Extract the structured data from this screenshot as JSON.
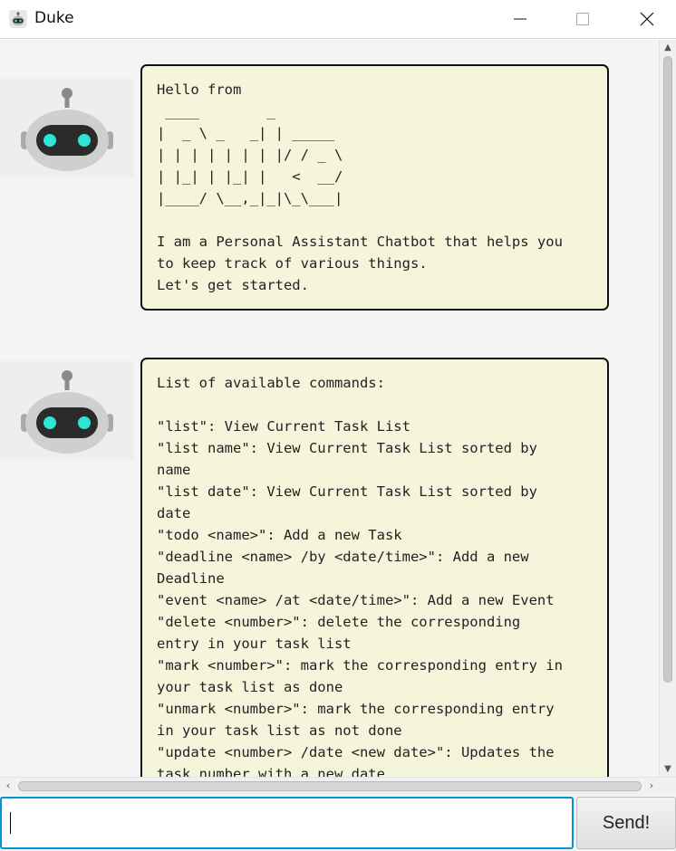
{
  "window": {
    "title": "Duke",
    "icon": "robot-icon",
    "controls": [
      "minimize-icon",
      "maximize-icon",
      "close-icon"
    ]
  },
  "dialog": [
    {
      "speaker": "duke",
      "avatar_icon": "robot-avatar-icon",
      "text": "Hello from\n ____        _\n|  _ \\ _   _| | _____\n| | | | | | | |/ / _ \\\n| |_| | |_| |   <  __/\n|____/ \\__,_|_|\\_\\___|\n\nI am a Personal Assistant Chatbot that helps you\nto keep track of various things.\nLet's get started."
    },
    {
      "speaker": "duke",
      "avatar_icon": "robot-avatar-icon",
      "text": "List of available commands:\n\n\"list\": View Current Task List\n\"list name\": View Current Task List sorted by\nname\n\"list date\": View Current Task List sorted by\ndate\n\"todo <name>\": Add a new Task\n\"deadline <name> /by <date/time>\": Add a new\nDeadline\n\"event <name> /at <date/time>\": Add a new Event\n\"delete <number>\": delete the corresponding\nentry in your task list\n\"mark <number>\": mark the corresponding entry in\nyour task list as done\n\"unmark <number>\": mark the corresponding entry\nin your task list as not done\n\"update <number> /date <new date>\": Updates the\ntask number with a new date"
    }
  ],
  "input": {
    "value": "",
    "placeholder": ""
  },
  "send_button": {
    "label": "Send!"
  },
  "colors": {
    "bubble_bg": "#f5f5dc",
    "bubble_border": "#111111",
    "input_focus": "#0096d6",
    "robot_eye": "#2ee6d6"
  }
}
